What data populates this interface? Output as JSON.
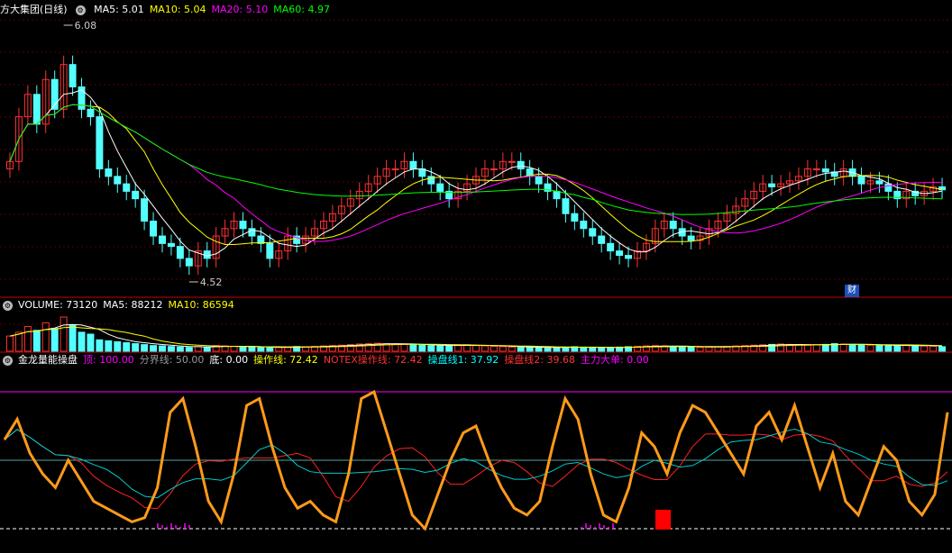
{
  "price_panel": {
    "title": "方大集团(日线)",
    "ma_labels": [
      {
        "name": "MA5: 5.01",
        "color": "#ffffff"
      },
      {
        "name": "MA10: 5.04",
        "color": "#ffff00"
      },
      {
        "name": "MA20: 5.10",
        "color": "#ff00ff"
      },
      {
        "name": "MA60: 4.97",
        "color": "#00ff00"
      }
    ],
    "high_label": "6.08",
    "low_label": "4.52",
    "badge": "财"
  },
  "volume_panel": {
    "labels": [
      {
        "name": "VOLUME: 73120",
        "color": "#ffffff"
      },
      {
        "name": "MA5: 88212",
        "color": "#ffffff"
      },
      {
        "name": "MA10: 86594",
        "color": "#ffff00"
      }
    ]
  },
  "indicator_panel": {
    "title": "金龙量能操盘",
    "labels": [
      {
        "name": "顶: 100.00",
        "color": "#ff00ff"
      },
      {
        "name": "分界线: 50.00",
        "color": "#999999"
      },
      {
        "name": "底: 0.00",
        "color": "#ffffff"
      },
      {
        "name": "操作线: 72.42",
        "color": "#ffff00"
      },
      {
        "name": "NOTEX操作线: 72.42",
        "color": "#ff3333"
      },
      {
        "name": "操盘线1: 37.92",
        "color": "#00ffff"
      },
      {
        "name": "操盘线2: 39.68",
        "color": "#ff3333"
      },
      {
        "name": "主力大单: 0.00",
        "color": "#ff00ff"
      }
    ]
  },
  "chart_data": {
    "type": "candlestick",
    "price_range": [
      4.4,
      6.2
    ],
    "closes": [
      5.25,
      5.55,
      5.7,
      5.5,
      5.8,
      5.6,
      5.9,
      5.75,
      5.6,
      5.55,
      5.2,
      5.15,
      5.1,
      5.05,
      5.0,
      4.85,
      4.75,
      4.7,
      4.68,
      4.6,
      4.55,
      4.65,
      4.6,
      4.75,
      4.8,
      4.85,
      4.8,
      4.75,
      4.7,
      4.6,
      4.65,
      4.75,
      4.7,
      4.75,
      4.8,
      4.85,
      4.9,
      4.95,
      5.0,
      5.05,
      5.1,
      5.15,
      5.2,
      5.2,
      5.25,
      5.2,
      5.15,
      5.1,
      5.05,
      5.0,
      5.05,
      5.1,
      5.15,
      5.2,
      5.2,
      5.25,
      5.25,
      5.2,
      5.15,
      5.1,
      5.05,
      5.0,
      4.9,
      4.85,
      4.8,
      4.75,
      4.7,
      4.65,
      4.62,
      4.6,
      4.65,
      4.7,
      4.8,
      4.85,
      4.8,
      4.75,
      4.72,
      4.75,
      4.8,
      4.85,
      4.9,
      4.95,
      5.0,
      5.05,
      5.1,
      5.08,
      5.1,
      5.12,
      5.15,
      5.2,
      5.2,
      5.18,
      5.15,
      5.2,
      5.15,
      5.1,
      5.12,
      5.1,
      5.05,
      5.0,
      5.05,
      5.02,
      5.05,
      5.08,
      5.06
    ],
    "volumes": [
      80,
      100,
      130,
      110,
      150,
      120,
      180,
      140,
      100,
      90,
      60,
      55,
      50,
      45,
      40,
      35,
      30,
      28,
      25,
      22,
      20,
      25,
      22,
      30,
      28,
      26,
      24,
      22,
      20,
      18,
      20,
      22,
      25,
      24,
      26,
      28,
      30,
      32,
      35,
      38,
      40,
      42,
      40,
      38,
      36,
      35,
      32,
      30,
      28,
      30,
      32,
      34,
      30,
      28,
      26,
      24,
      22,
      20,
      22,
      20,
      18,
      20,
      22,
      24,
      22,
      20,
      18,
      20,
      22,
      24,
      26,
      28,
      30,
      28,
      26,
      24,
      22,
      20,
      22,
      24,
      26,
      28,
      30,
      32,
      34,
      36,
      38,
      36,
      34,
      32,
      34,
      36,
      40,
      38,
      36,
      34,
      32,
      30,
      28,
      30,
      32,
      30,
      28,
      26,
      24
    ],
    "indicator_range": [
      0,
      100
    ],
    "operation_line": [
      65,
      80,
      55,
      40,
      30,
      50,
      35,
      20,
      15,
      10,
      5,
      8,
      30,
      85,
      95,
      60,
      20,
      5,
      40,
      90,
      95,
      60,
      30,
      15,
      20,
      10,
      5,
      40,
      95,
      100,
      70,
      40,
      10,
      0,
      25,
      50,
      70,
      75,
      50,
      30,
      15,
      10,
      20,
      60,
      95,
      80,
      40,
      10,
      5,
      30,
      70,
      60,
      40,
      70,
      90,
      85,
      70,
      55,
      40,
      75,
      85,
      65,
      90,
      60,
      30,
      55,
      20,
      10,
      35,
      60,
      50,
      20,
      10,
      25,
      85
    ]
  }
}
